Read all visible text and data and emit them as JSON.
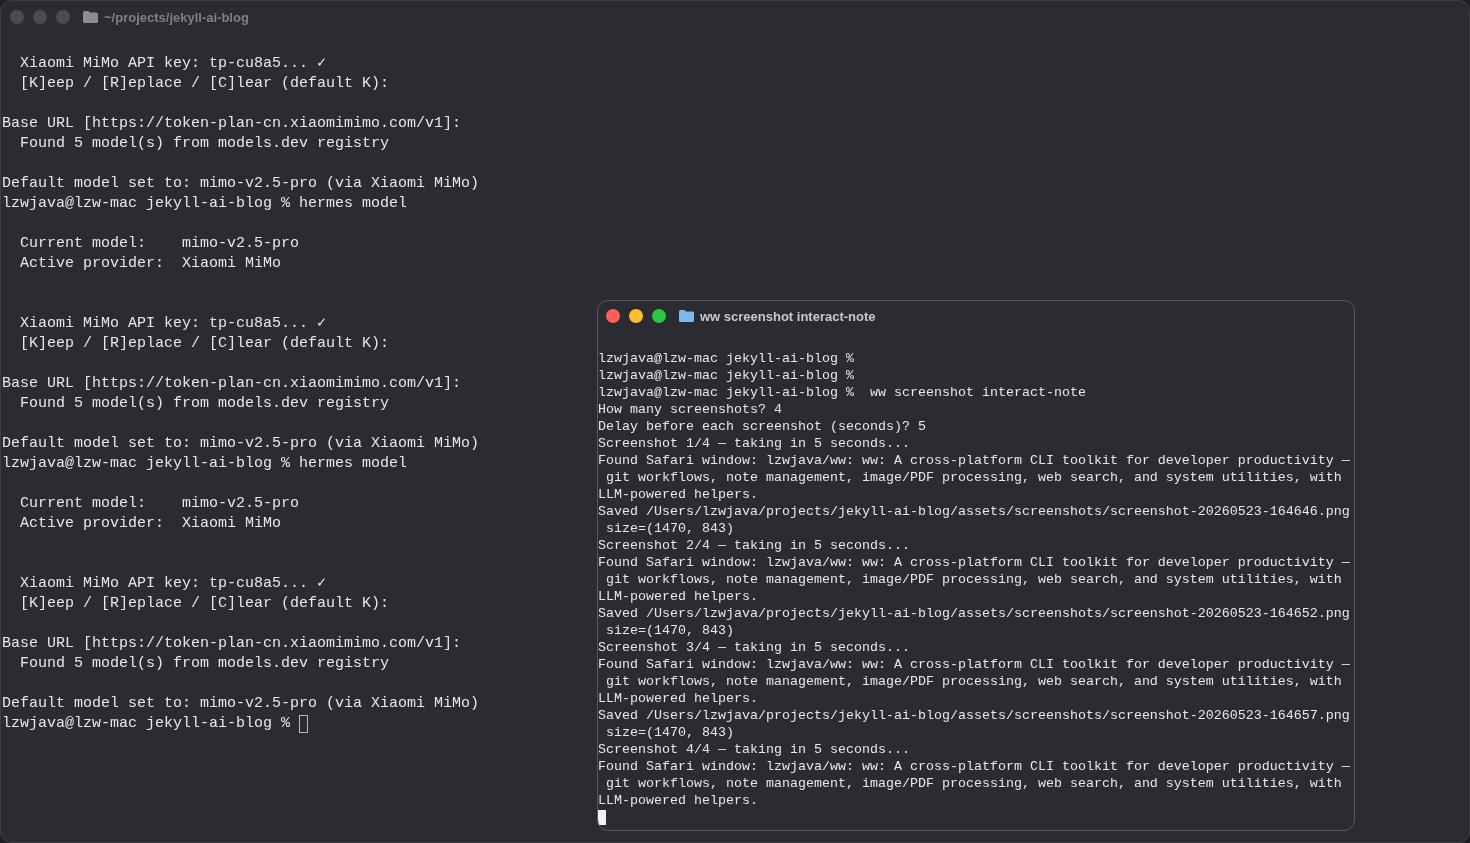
{
  "windows": [
    {
      "title": "~/projects/jekyll-ai-blog",
      "active": false,
      "blocks": [
        {
          "kind": "output",
          "lines": [
            "  Xiaomi MiMo API key: tp-cu8a5... ✓",
            "  [K]eep / [R]eplace / [C]lear (default K):"
          ]
        },
        {
          "kind": "output",
          "lines": [
            "Base URL [https://token-plan-cn.xiaomimimo.com/v1]:",
            "  Found 5 model(s) from models.dev registry"
          ]
        },
        {
          "kind": "output",
          "lines": [
            "Default model set to: mimo-v2.5-pro (via Xiaomi MiMo)",
            "lzwjava@lzw-mac jekyll-ai-blog % hermes model"
          ]
        },
        {
          "kind": "status",
          "lines": [
            "  Current model:    mimo-v2.5-pro",
            "  Active provider:  Xiaomi MiMo"
          ]
        },
        {
          "kind": "output",
          "lines": [
            "  Xiaomi MiMo API key: tp-cu8a5... ✓",
            "  [K]eep / [R]eplace / [C]lear (default K):"
          ]
        },
        {
          "kind": "output",
          "lines": [
            "Base URL [https://token-plan-cn.xiaomimimo.com/v1]:",
            "  Found 5 model(s) from models.dev registry"
          ]
        },
        {
          "kind": "output",
          "lines": [
            "Default model set to: mimo-v2.5-pro (via Xiaomi MiMo)",
            "lzwjava@lzw-mac jekyll-ai-blog % hermes model"
          ]
        },
        {
          "kind": "status",
          "lines": [
            "  Current model:    mimo-v2.5-pro",
            "  Active provider:  Xiaomi MiMo"
          ]
        },
        {
          "kind": "output",
          "lines": [
            "  Xiaomi MiMo API key: tp-cu8a5... ✓",
            "  [K]eep / [R]eplace / [C]lear (default K):"
          ]
        },
        {
          "kind": "output",
          "lines": [
            "Base URL [https://token-plan-cn.xiaomimimo.com/v1]:",
            "  Found 5 model(s) from models.dev registry"
          ]
        },
        {
          "kind": "prompt",
          "lines": [
            "Default model set to: mimo-v2.5-pro (via Xiaomi MiMo)",
            "lzwjava@lzw-mac jekyll-ai-blog % "
          ]
        }
      ]
    },
    {
      "title": "ww screenshot interact-note",
      "active": true,
      "blocks": [
        {
          "kind": "output",
          "lines": [
            "lzwjava@lzw-mac jekyll-ai-blog %",
            "lzwjava@lzw-mac jekyll-ai-blog %",
            "lzwjava@lzw-mac jekyll-ai-blog %  ww screenshot interact-note",
            "How many screenshots? 4",
            "Delay before each screenshot (seconds)? 5",
            "Screenshot 1/4 — taking in 5 seconds...",
            "Found Safari window: lzwjava/ww: ww: A cross-platform CLI toolkit for developer productivity —",
            " git workflows, note management, image/PDF processing, web search, and system utilities, with",
            "LLM-powered helpers.",
            "Saved /Users/lzwjava/projects/jekyll-ai-blog/assets/screenshots/screenshot-20260523-164646.png",
            " size=(1470, 843)",
            "Screenshot 2/4 — taking in 5 seconds...",
            "Found Safari window: lzwjava/ww: ww: A cross-platform CLI toolkit for developer productivity —",
            " git workflows, note management, image/PDF processing, web search, and system utilities, with",
            "LLM-powered helpers.",
            "Saved /Users/lzwjava/projects/jekyll-ai-blog/assets/screenshots/screenshot-20260523-164652.png",
            " size=(1470, 843)",
            "Screenshot 3/4 — taking in 5 seconds...",
            "Found Safari window: lzwjava/ww: ww: A cross-platform CLI toolkit for developer productivity —",
            " git workflows, note management, image/PDF processing, web search, and system utilities, with",
            "LLM-powered helpers.",
            "Saved /Users/lzwjava/projects/jekyll-ai-blog/assets/screenshots/screenshot-20260523-164657.png",
            " size=(1470, 843)",
            "Screenshot 4/4 — taking in 5 seconds...",
            "Found Safari window: lzwjava/ww: ww: A cross-platform CLI toolkit for developer productivity —",
            " git workflows, note management, image/PDF processing, web search, and system utilities, with",
            "LLM-powered helpers."
          ]
        },
        {
          "kind": "cursor"
        }
      ]
    }
  ]
}
